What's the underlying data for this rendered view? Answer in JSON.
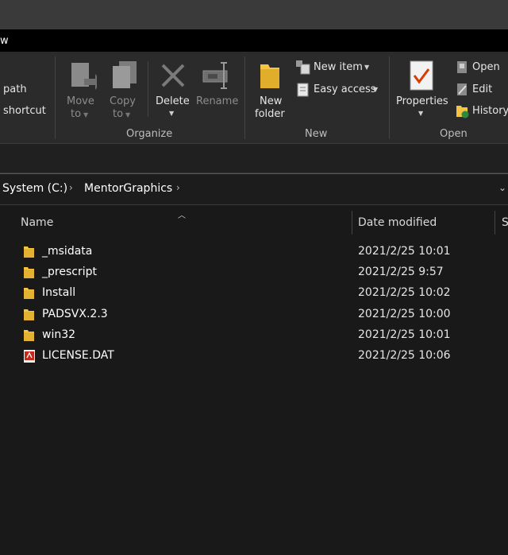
{
  "window": {
    "tab_fragment": "w"
  },
  "ribbon": {
    "clipboard": {
      "copy_path_label": "path",
      "paste_shortcut_label": "shortcut"
    },
    "organize": {
      "move_to_line1": "Move",
      "move_to_line2": "to",
      "copy_to_line1": "Copy",
      "copy_to_line2": "to",
      "delete_label": "Delete",
      "rename_label": "Rename",
      "group_label": "Organize"
    },
    "new": {
      "new_folder_line1": "New",
      "new_folder_line2": "folder",
      "new_item_label": "New item",
      "easy_access_label": "Easy access",
      "group_label": "New"
    },
    "open": {
      "properties_label": "Properties",
      "open_label": "Open",
      "edit_label": "Edit",
      "history_label": "History",
      "group_label": "Open"
    }
  },
  "address_bar": {
    "crumbs": [
      "System (C:)",
      "MentorGraphics"
    ]
  },
  "file_list": {
    "columns": {
      "name": "Name",
      "date_modified": "Date modified",
      "type_fragment": "S"
    },
    "rows": [
      {
        "name": "_msidata",
        "date": "2021/2/25 10:01",
        "icon": "folder-icon"
      },
      {
        "name": "_prescript",
        "date": "2021/2/25 9:57",
        "icon": "folder-icon"
      },
      {
        "name": "Install",
        "date": "2021/2/25 10:02",
        "icon": "folder-icon"
      },
      {
        "name": "PADSVX.2.3",
        "date": "2021/2/25 10:00",
        "icon": "folder-icon"
      },
      {
        "name": "win32",
        "date": "2021/2/25 10:01",
        "icon": "folder-icon"
      },
      {
        "name": "LICENSE.DAT",
        "date": "2021/2/25 10:06",
        "icon": "pdf-file-icon"
      }
    ]
  },
  "colors": {
    "background": "#191919",
    "ribbon": "#2b2b2b",
    "folder": "#f5c542",
    "pdf": "#c42b1c"
  }
}
